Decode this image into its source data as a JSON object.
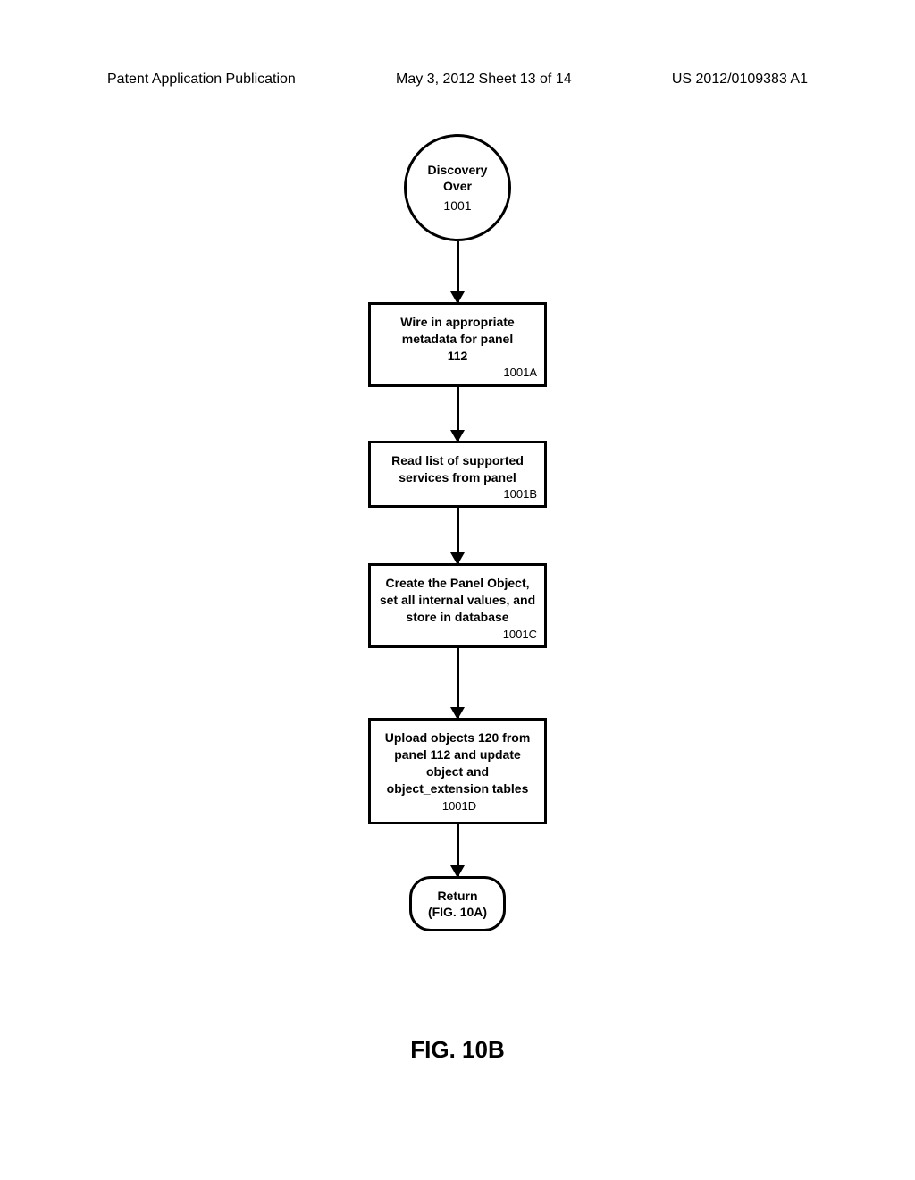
{
  "header": {
    "left": "Patent Application Publication",
    "center": "May 3, 2012   Sheet 13 of 14",
    "right": "US 2012/0109383 A1"
  },
  "flow": {
    "start": {
      "line1": "Discovery",
      "line2": "Over",
      "ref": "1001"
    },
    "step_a": {
      "text": "Wire in appropriate metadata for panel",
      "inner_ref": "112",
      "ref": "1001A"
    },
    "step_b": {
      "text": "Read list of supported services from panel",
      "ref": "1001B"
    },
    "step_c": {
      "text": "Create the Panel Object, set all internal values, and store in database",
      "ref": "1001C"
    },
    "step_d": {
      "text": "Upload objects 120 from panel 112 and update object and object_extension tables",
      "ref": "1001D"
    },
    "end": {
      "line1": "Return",
      "line2": "(FIG. 10A)"
    }
  },
  "figure_label": "FIG. 10B"
}
